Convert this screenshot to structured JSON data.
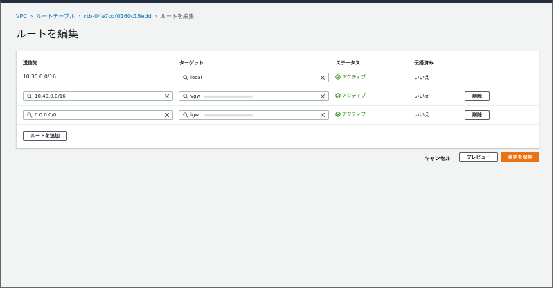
{
  "breadcrumb": {
    "items": [
      "VPC",
      "ルートテーブル",
      "rtb-04e7cdf0160c18edd"
    ],
    "current": "ルートを編集"
  },
  "page": {
    "title": "ルートを編集"
  },
  "table": {
    "headers": [
      "送信先",
      "ターゲット",
      "ステータス",
      "伝播済み"
    ],
    "rows": [
      {
        "destination": "10.30.0.0/16",
        "target": "local",
        "status": "アクティブ",
        "propagated": "いいえ"
      },
      {
        "destination": "10.40.0.0/16",
        "target": "vgw",
        "status": "アクティブ",
        "propagated": "いいえ",
        "remove_label": "削除"
      },
      {
        "destination": "0.0.0.0/0",
        "target": "igw",
        "status": "アクティブ",
        "propagated": "いいえ",
        "remove_label": "削除"
      }
    ],
    "add_route_label": "ルートを追加"
  },
  "footer": {
    "cancel_label": "キャンセル",
    "preview_label": "プレビュー",
    "save_label": "変更を保存"
  },
  "colors": {
    "link": "#0073bb",
    "success": "#1d8102",
    "primary": "#ec7211",
    "header_bar": "#232f3e"
  }
}
